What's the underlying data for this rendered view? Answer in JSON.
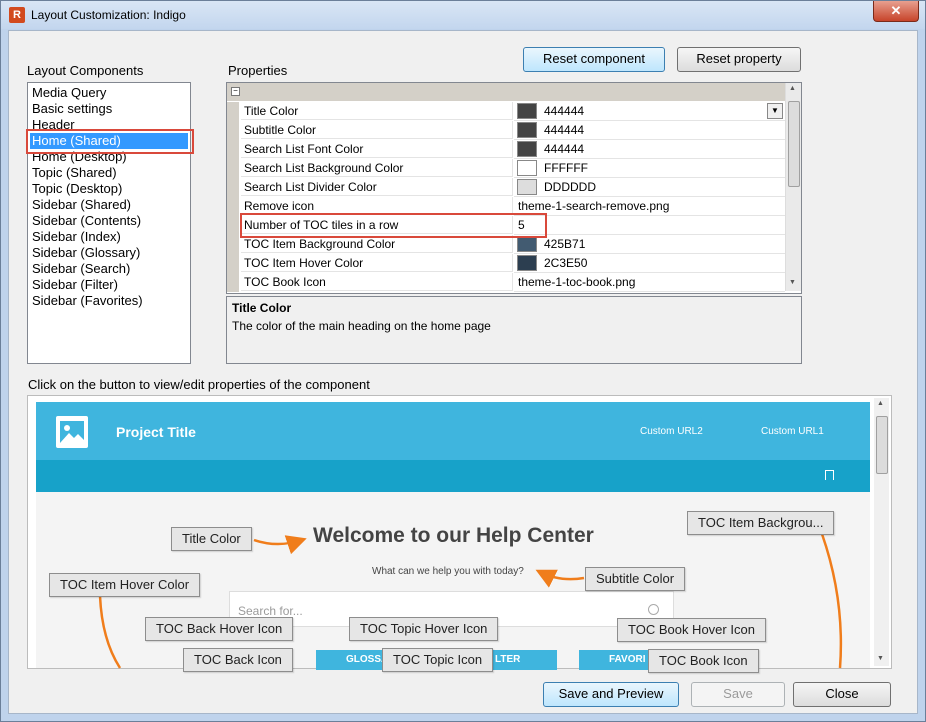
{
  "window": {
    "title": "Layout Customization: Indigo",
    "close_glyph": "✕"
  },
  "layout_components": {
    "label": "Layout Components",
    "items": [
      "Media Query",
      "Basic settings",
      "Header",
      "Home (Shared)",
      "Home (Desktop)",
      "Topic (Shared)",
      "Topic (Desktop)",
      "Sidebar (Shared)",
      "Sidebar (Contents)",
      "Sidebar (Index)",
      "Sidebar (Glossary)",
      "Sidebar (Search)",
      "Sidebar (Filter)",
      "Sidebar (Favorites)"
    ],
    "selected_index": 3
  },
  "toolbar": {
    "reset_component": "Reset component",
    "reset_property": "Reset property"
  },
  "properties": {
    "label": "Properties",
    "rows": [
      {
        "name": "Title Color",
        "value": "444444",
        "swatch": "#444444",
        "dropdown": true
      },
      {
        "name": "Subtitle Color",
        "value": "444444",
        "swatch": "#444444"
      },
      {
        "name": "Search List Font Color",
        "value": "444444",
        "swatch": "#444444"
      },
      {
        "name": "Search List Background Color",
        "value": "FFFFFF",
        "swatch": "#FFFFFF"
      },
      {
        "name": "Search List Divider Color",
        "value": "DDDDDD",
        "swatch": "#DDDDDD"
      },
      {
        "name": "Remove icon",
        "value": "theme-1-search-remove.png"
      },
      {
        "name": "Number of TOC tiles in a row",
        "value": "5"
      },
      {
        "name": "TOC Item Background Color",
        "value": "425B71",
        "swatch": "#425B71"
      },
      {
        "name": "TOC Item Hover Color",
        "value": "2C3E50",
        "swatch": "#2C3E50"
      },
      {
        "name": "TOC Book Icon",
        "value": "theme-1-toc-book.png"
      }
    ]
  },
  "description": {
    "title": "Title Color",
    "text": "The color of the main heading on the home page"
  },
  "preview": {
    "hint": "Click on the button to view/edit properties of the component",
    "project_title": "Project Title",
    "custom_url_2": "Custom URL2",
    "custom_url_1": "Custom URL1",
    "welcome": "Welcome to our Help Center",
    "subtitle": "What can we help you with today?",
    "search_placeholder": "Search for...",
    "tiles": [
      "GLOSSA",
      "LTER",
      "FAVORI"
    ],
    "tags": {
      "title_color": "Title Color",
      "toc_item_background": "TOC Item Backgrou...",
      "toc_item_hover_color": "TOC Item Hover Color",
      "subtitle_color": "Subtitle Color",
      "toc_back_hover_icon": "TOC Back Hover Icon",
      "toc_topic_hover_icon": "TOC Topic Hover Icon",
      "toc_book_hover_icon": "TOC Book Hover Icon",
      "toc_back_icon": "TOC Back Icon",
      "toc_topic_icon": "TOC Topic Icon",
      "toc_book_icon": "TOC Book Icon"
    },
    "colors": {
      "header": "#3fb5de",
      "nav": "#17a2c9",
      "arrow": "#f07d1b"
    }
  },
  "footer": {
    "save_and_preview": "Save and Preview",
    "save": "Save",
    "close": "Close"
  },
  "colors": {
    "highlight_box": "#d9493b",
    "selection": "#3399ff"
  }
}
